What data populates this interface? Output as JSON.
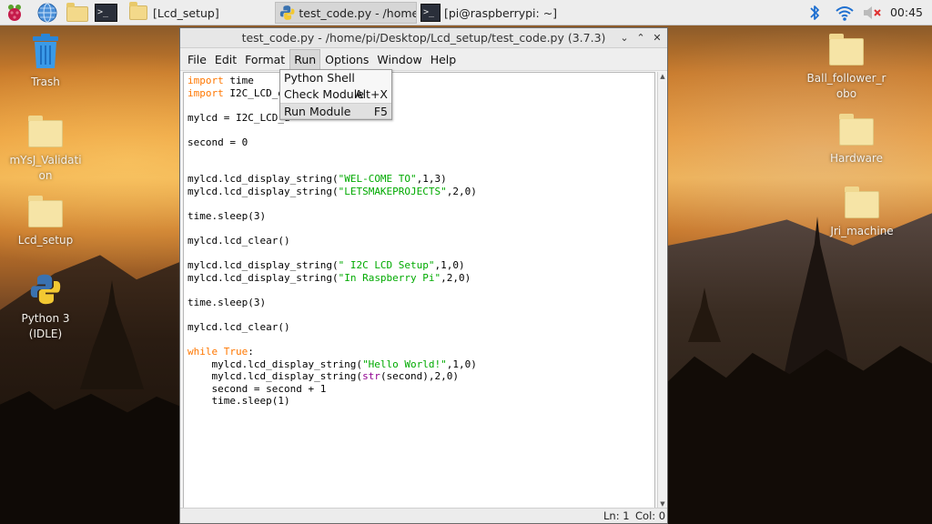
{
  "taskbar": {
    "tasks": [
      {
        "label": "[Lcd_setup]",
        "icon": "folder-icon"
      },
      {
        "label": "test_code.py - /home/...",
        "icon": "python-icon"
      },
      {
        "label": "[pi@raspberrypi: ~]",
        "icon": "terminal-icon"
      }
    ],
    "clock": "00:45",
    "terminal_glyph": ">_"
  },
  "desktop": {
    "left_icons": [
      {
        "label": "Trash"
      },
      {
        "label": "mYsJ_Validati on"
      },
      {
        "label": "Lcd_setup"
      },
      {
        "label": "Python 3 (IDLE)"
      }
    ],
    "right_icons": [
      {
        "label": "Ball_follower_r obo"
      },
      {
        "label": "Hardware"
      },
      {
        "label": "Jri_machine"
      }
    ]
  },
  "window": {
    "title": "test_code.py - /home/pi/Desktop/Lcd_setup/test_code.py (3.7.3)",
    "controls": {
      "minimize": "⌄",
      "maximize": "⌃",
      "close": "✕"
    },
    "menu": [
      "File",
      "Edit",
      "Format",
      "Run",
      "Options",
      "Window",
      "Help"
    ],
    "status": {
      "line": "Ln: 1",
      "col": "Col: 0"
    }
  },
  "run_menu": {
    "items": [
      {
        "label": "Python Shell",
        "accel": ""
      },
      {
        "label": "Check Module",
        "accel": "Alt+X"
      },
      {
        "label": "Run Module",
        "accel": "F5"
      }
    ]
  },
  "code": {
    "line1_kw": "import",
    "line1_rest": " time",
    "line2_kw": "import",
    "line2_rest": " I2C_LCD_dr",
    "line4": "mylcd = I2C_LCD_d",
    "line6": "second = 0",
    "line9_a": "mylcd.lcd_display_string(",
    "line9_s": "\"WEL-COME TO\"",
    "line9_b": ",1,3)",
    "line10_a": "mylcd.lcd_display_string(",
    "line10_s": "\"LETSMAKEPROJECTS\"",
    "line10_b": ",2,0)",
    "line12": "time.sleep(3)",
    "line14": "mylcd.lcd_clear()",
    "line16_a": "mylcd.lcd_display_string(",
    "line16_s": "\" I2C LCD Setup\"",
    "line16_b": ",1,0)",
    "line17_a": "mylcd.lcd_display_string(",
    "line17_s": "\"In Raspberry Pi\"",
    "line17_b": ",2,0)",
    "line19": "time.sleep(3)",
    "line21": "mylcd.lcd_clear()",
    "line23_kw": "while",
    "line23_kw2": "True",
    "line23_b": ":",
    "line24_a": "    mylcd.lcd_display_string(",
    "line24_s": "\"Hello World!\"",
    "line24_b": ",1,0)",
    "line25_a": "    mylcd.lcd_display_string(",
    "line25_bi": "str",
    "line25_b": "(second),2,0)",
    "line26": "    second = second + 1",
    "line27": "    time.sleep(1)"
  }
}
